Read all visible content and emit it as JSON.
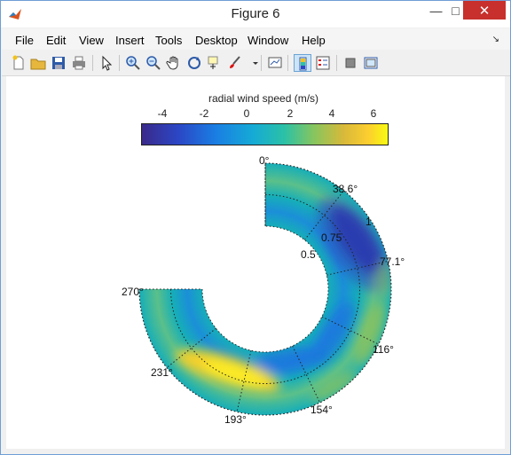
{
  "window": {
    "title": "Figure 6"
  },
  "menu": {
    "items": [
      "File",
      "Edit",
      "View",
      "Insert",
      "Tools",
      "Desktop",
      "Window",
      "Help"
    ]
  },
  "colorbar": {
    "label": "radial wind speed (m/s)",
    "ticks": [
      "-4",
      "-2",
      "0",
      "2",
      "4",
      "6"
    ],
    "min": -5,
    "max": 7
  },
  "polar": {
    "angle_labels": [
      "0°",
      "38.6°",
      "77.1°",
      "116°",
      "154°",
      "193°",
      "231°",
      "270°"
    ],
    "radius_labels": [
      "0.5",
      "0.75",
      "1"
    ]
  },
  "chart_data": {
    "type": "heatmap",
    "colorbar_label": "radial wind speed (m/s)",
    "color_range": [
      -5,
      7
    ],
    "theta_range_deg": [
      0,
      270
    ],
    "theta_ticks_deg": [
      0,
      38.6,
      77.1,
      116,
      154,
      193,
      231,
      270
    ],
    "r_range": [
      0.5,
      1.0
    ],
    "r_ticks": [
      0.5,
      0.75,
      1
    ],
    "grid": true
  }
}
